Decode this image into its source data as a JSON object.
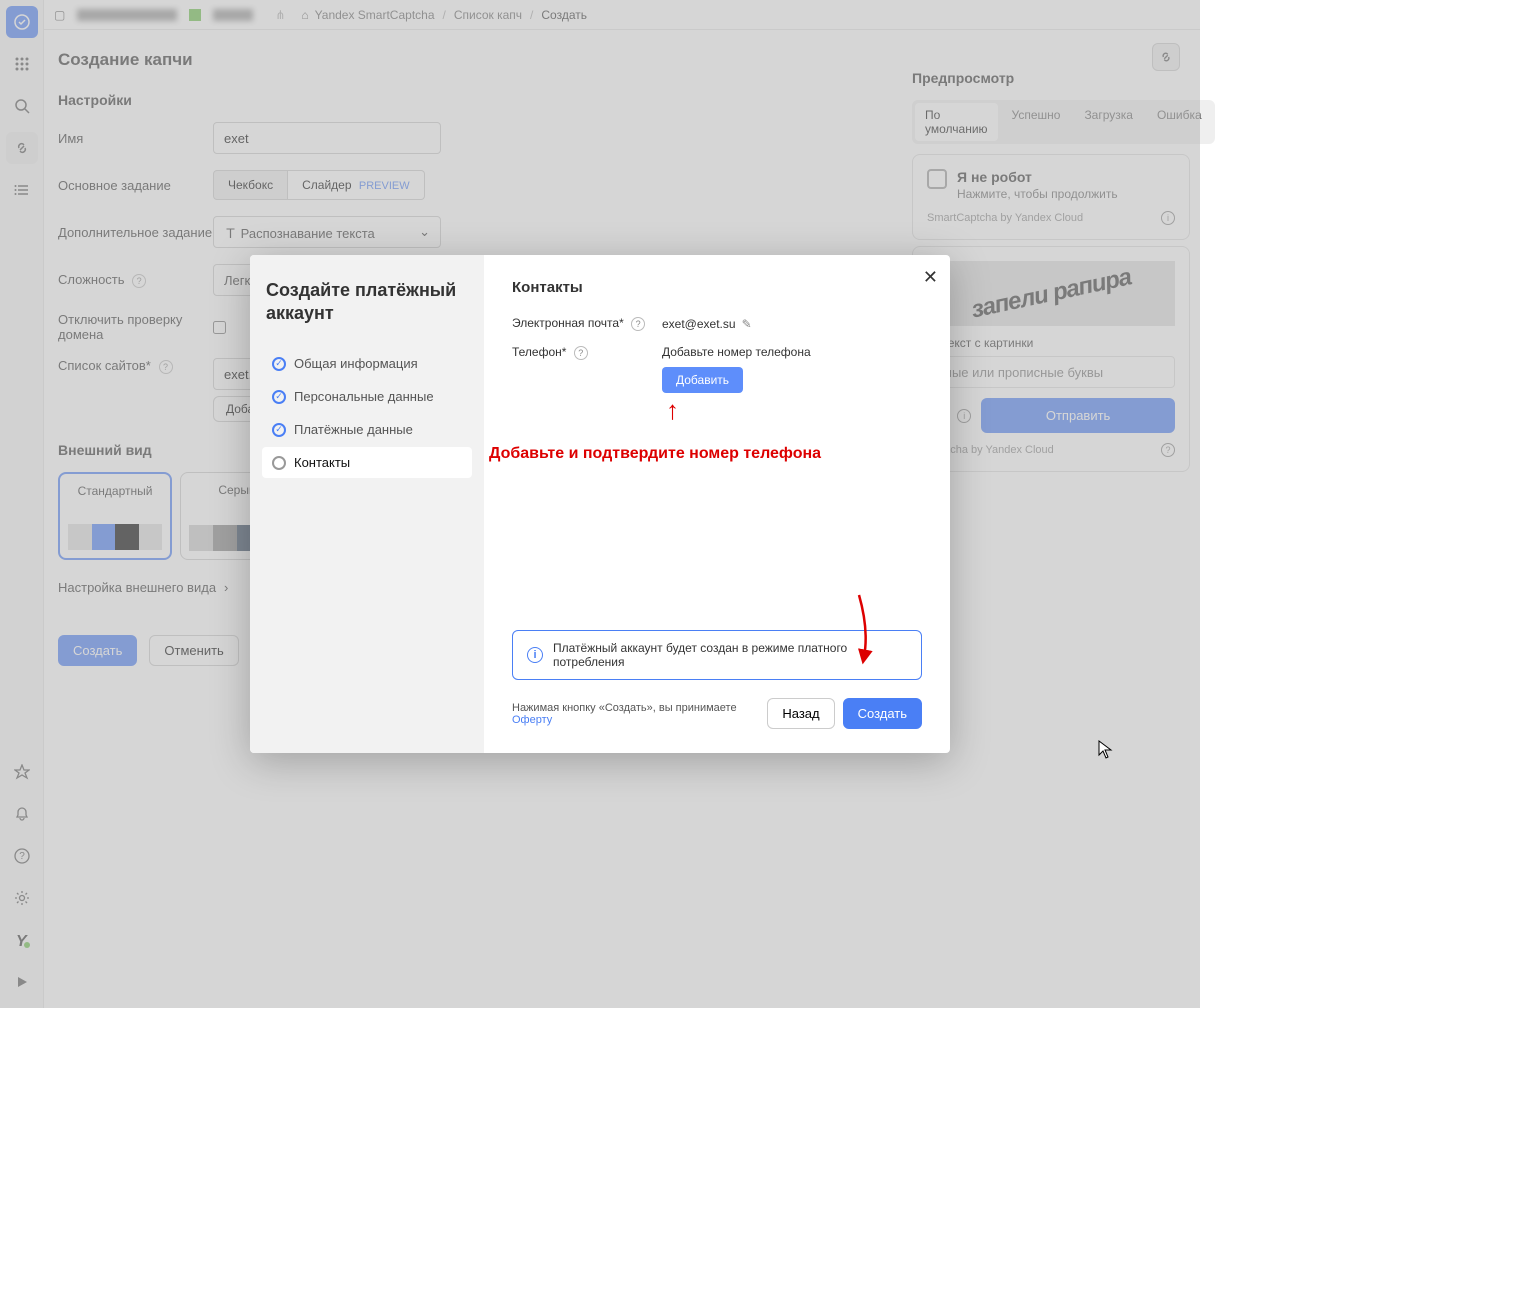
{
  "breadcrumb": {
    "p1": "Yandex SmartCaptcha",
    "p2": "Список капч",
    "p3": "Создать"
  },
  "page": {
    "title": "Создание капчи",
    "settings_h": "Настройки"
  },
  "form": {
    "name_label": "Имя",
    "name_value": "exet",
    "basic_label": "Основное задание",
    "basic_opt1": "Чекбокс",
    "basic_opt2": "Слайдер",
    "preview_badge": "PREVIEW",
    "extra_label": "Дополнительное задание",
    "extra_value": "Распознавание текста",
    "diff_label": "Сложность",
    "diff_value": "Легкая",
    "domain_label": "Отключить проверку домена",
    "sites_label": "Список сайтов*",
    "sites_value": "exet.su",
    "add_label": "Добавить"
  },
  "appearance": {
    "h": "Внешний вид",
    "theme1": "Стандартный",
    "theme2": "Серый",
    "config_h": "Настройка внешнего вида"
  },
  "footer": {
    "create": "Создать",
    "cancel": "Отменить"
  },
  "preview": {
    "h": "Предпросмотр",
    "tab_default": "По умолчанию",
    "tab_success": "Успешно",
    "tab_loading": "Загрузка",
    "tab_error": "Ошибка",
    "robot": "Я не робот",
    "robot_sub": "Нажмите, чтобы продолжить",
    "brand": "SmartCaptcha by Yandex Cloud",
    "challenge_word": "запели рапира",
    "enter_text": "те текст с картинки",
    "placeholder": "чные или прописные буквы",
    "send": "Отправить",
    "footer_brand": "Captcha by Yandex Cloud"
  },
  "modal": {
    "title": "Создайте платёжный аккаунт",
    "step1": "Общая информация",
    "step2": "Персональные данные",
    "step3": "Платёжные данные",
    "step4": "Контакты",
    "right_h": "Контакты",
    "email_label": "Электронная почта*",
    "email_value": "exet@exet.su",
    "phone_label": "Телефон*",
    "phone_hint": "Добавьте номер телефона",
    "add_btn": "Добавить",
    "info": "Платёжный аккаунт будет создан в режиме платного потребления",
    "offer_text": "Нажимая кнопку «Создать», вы принимаете ",
    "offer_link": "Оферту",
    "back": "Назад",
    "create": "Создать"
  },
  "annotation": "Добавьте и подтвердите номер телефона"
}
